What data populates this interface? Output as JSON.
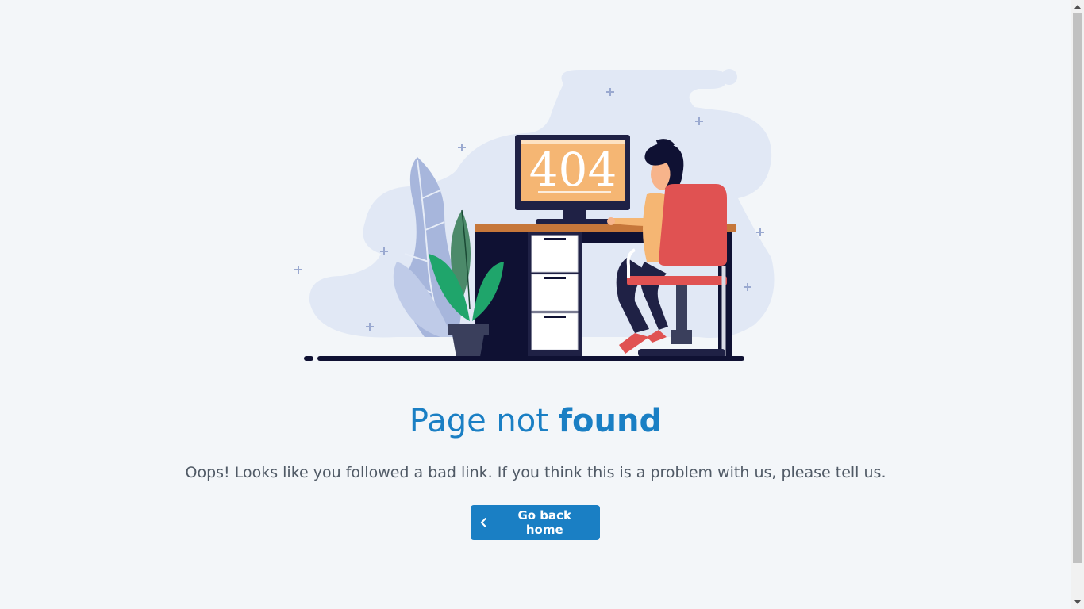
{
  "screen": {
    "monitor_text": "404"
  },
  "content": {
    "title_part1": "Page not ",
    "title_part2": "found",
    "message": "Oops! Looks like you followed a bad link. If you think this is a problem with us, please tell us.",
    "button_label": "Go back home",
    "button_icon": "chevron-left-icon"
  },
  "colors": {
    "background": "#f3f6f9",
    "accent": "#1a7fc4",
    "text_muted": "#505a66",
    "monitor_screen": "#f5b673",
    "chair": "#e05252",
    "plant": "#1fa56b"
  }
}
